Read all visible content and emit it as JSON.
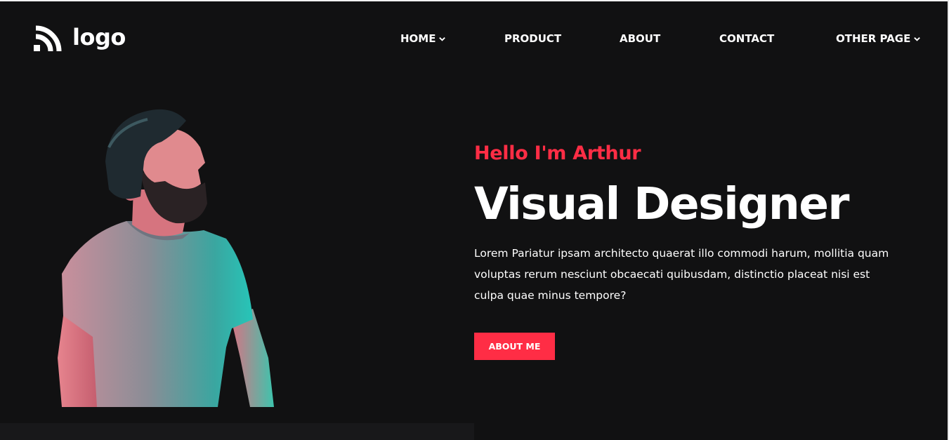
{
  "header": {
    "logo_text": "logo",
    "nav": [
      {
        "label": "HOME",
        "has_dropdown": true
      },
      {
        "label": "PRODUCT",
        "has_dropdown": false
      },
      {
        "label": "ABOUT",
        "has_dropdown": false
      },
      {
        "label": "CONTACT",
        "has_dropdown": false
      },
      {
        "label": "OTHER PAGE",
        "has_dropdown": true
      }
    ]
  },
  "hero": {
    "greeting": "Hello I'm Arthur",
    "headline": "Visual Designer",
    "description": "Lorem Pariatur ipsam architecto quaerat illo commodi harum, mollitia quam voluptas rerum nesciunt obcaecati quibusdam, distinctio placeat nisi est culpa quae minus tempore?",
    "button_label": "ABOUT ME"
  },
  "icons": {
    "logo": "logo-arcs-icon",
    "dropdown": "chevron-down-icon"
  },
  "colors": {
    "background": "#111112",
    "accent": "#ff2d45",
    "text": "#ffffff"
  }
}
